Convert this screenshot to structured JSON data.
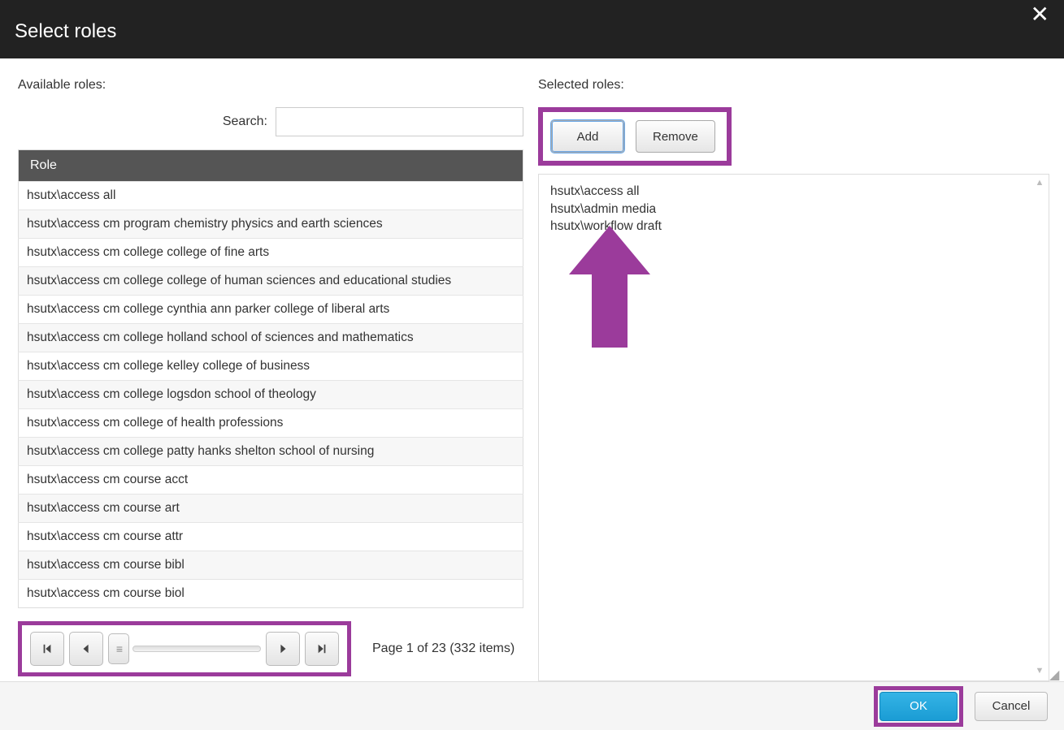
{
  "dialog": {
    "title": "Select roles"
  },
  "left": {
    "section_label": "Available roles:",
    "search_label": "Search:",
    "search_value": "",
    "table_header": "Role",
    "rows": [
      "hsutx\\access all",
      "hsutx\\access cm program chemistry physics and earth sciences",
      "hsutx\\access cm college college of fine arts",
      "hsutx\\access cm college college of human sciences and educational studies",
      "hsutx\\access cm college cynthia ann parker college of liberal arts",
      "hsutx\\access cm college holland school of sciences and mathematics",
      "hsutx\\access cm college kelley college of business",
      "hsutx\\access cm college logsdon school of theology",
      "hsutx\\access cm college of health professions",
      "hsutx\\access cm college patty hanks shelton school of nursing",
      "hsutx\\access cm course acct",
      "hsutx\\access cm course art",
      "hsutx\\access cm course attr",
      "hsutx\\access cm course bibl",
      "hsutx\\access cm course biol"
    ],
    "pager_info": "Page 1 of 23 (332 items)"
  },
  "right": {
    "section_label": "Selected roles:",
    "add_label": "Add",
    "remove_label": "Remove",
    "selected": [
      "hsutx\\access all",
      "hsutx\\admin media",
      "hsutx\\workflow draft"
    ]
  },
  "footer": {
    "ok_label": "OK",
    "cancel_label": "Cancel"
  }
}
